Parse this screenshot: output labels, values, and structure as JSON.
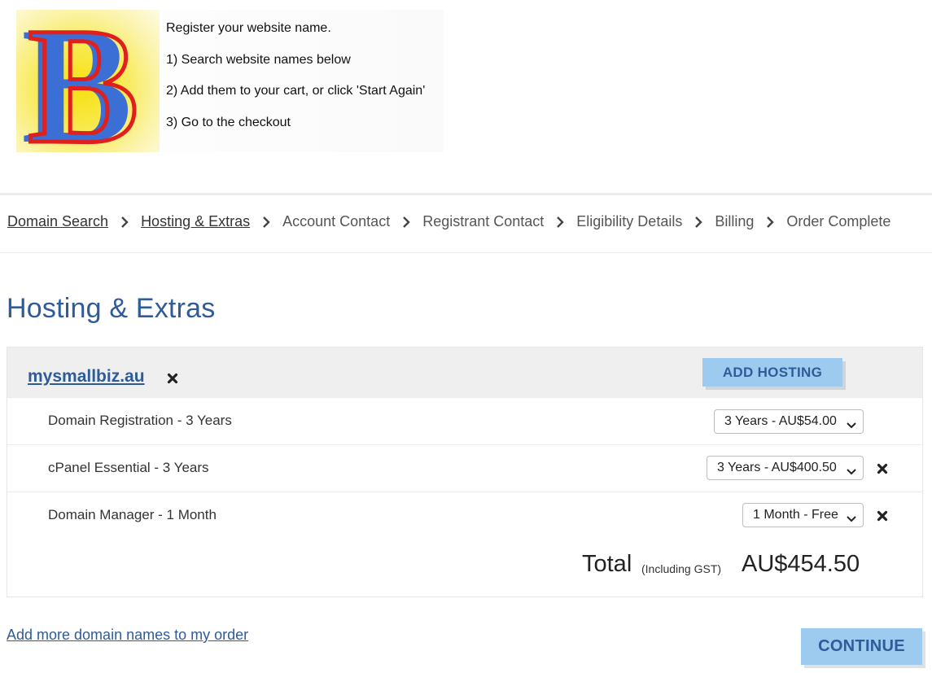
{
  "banner": {
    "logo_letter": "B",
    "lines": [
      "Register your website name.",
      "1) Search website names below",
      "2) Add them to your cart, or click 'Start Again'",
      "3) Go to the checkout"
    ]
  },
  "breadcrumb": {
    "steps": [
      {
        "label": "Domain Search",
        "link": true
      },
      {
        "label": "Hosting & Extras",
        "link": true
      },
      {
        "label": "Account Contact",
        "link": false
      },
      {
        "label": "Registrant Contact",
        "link": false
      },
      {
        "label": "Eligibility Details",
        "link": false
      },
      {
        "label": "Billing",
        "link": false
      },
      {
        "label": "Order Complete",
        "link": false
      }
    ],
    "separator_icon": "chevron-right-icon"
  },
  "page_title": "Hosting & Extras",
  "order": {
    "domain": "mysmallbiz.au",
    "add_hosting_label": "ADD HOSTING",
    "items": [
      {
        "name": "Domain Registration",
        "sep": " - ",
        "term": "3 Years",
        "option": "3 Years - AU$54.00",
        "removable": false
      },
      {
        "name": "cPanel Essential",
        "sep": " - ",
        "term": "3 Years",
        "option": "3 Years - AU$400.50",
        "removable": true
      },
      {
        "name": "Domain Manager",
        "sep": " - ",
        "term": "1 Month",
        "option": "1 Month - Free",
        "removable": true
      }
    ],
    "total_label": "Total",
    "total_note": "(Including GST)",
    "total_amount": "AU$454.50"
  },
  "footer": {
    "add_more_label": "Add more domain names to my order",
    "continue_label": "CONTINUE"
  },
  "colors": {
    "accent": "#2f5b99",
    "button_bg": "#9ccbef",
    "panel_header_bg": "#efefef"
  }
}
